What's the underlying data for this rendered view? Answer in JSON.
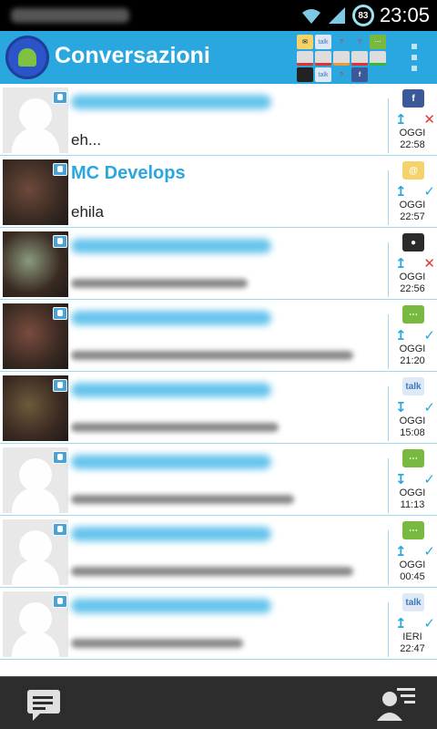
{
  "status": {
    "time": "23:05",
    "battery": "83"
  },
  "app": {
    "title": "Conversazioni"
  },
  "conversations": [
    {
      "name": "",
      "preview": "eh...",
      "source": "facebook",
      "direction": "up",
      "status": "failed",
      "day": "OGGI",
      "time": "22:58",
      "photo": false
    },
    {
      "name": "MC Develops",
      "preview": "ehila",
      "source": "email",
      "direction": "up",
      "status": "ok",
      "day": "OGGI",
      "time": "22:57",
      "photo": true,
      "color": "#6b4a3a"
    },
    {
      "name": "",
      "preview": "",
      "source": "msn",
      "direction": "up",
      "status": "failed",
      "day": "OGGI",
      "time": "22:56",
      "photo": true,
      "color": "#8a9a7d"
    },
    {
      "name": "",
      "preview": "",
      "source": "sms",
      "direction": "up",
      "status": "ok",
      "day": "OGGI",
      "time": "21:20",
      "photo": true,
      "color": "#7b4b3f"
    },
    {
      "name": "",
      "preview": "",
      "source": "talk",
      "direction": "down",
      "status": "ok",
      "day": "OGGI",
      "time": "15:08",
      "photo": true,
      "color": "#6e5a3a"
    },
    {
      "name": "",
      "preview": "",
      "source": "sms",
      "direction": "down",
      "status": "ok",
      "day": "OGGI",
      "time": "11:13",
      "photo": false
    },
    {
      "name": "",
      "preview": "",
      "source": "sms",
      "direction": "up",
      "status": "ok",
      "day": "OGGI",
      "time": "00:45",
      "photo": false
    },
    {
      "name": "",
      "preview": "",
      "source": "talk",
      "direction": "up",
      "status": "ok",
      "day": "IERI",
      "time": "22:47",
      "photo": false
    }
  ]
}
